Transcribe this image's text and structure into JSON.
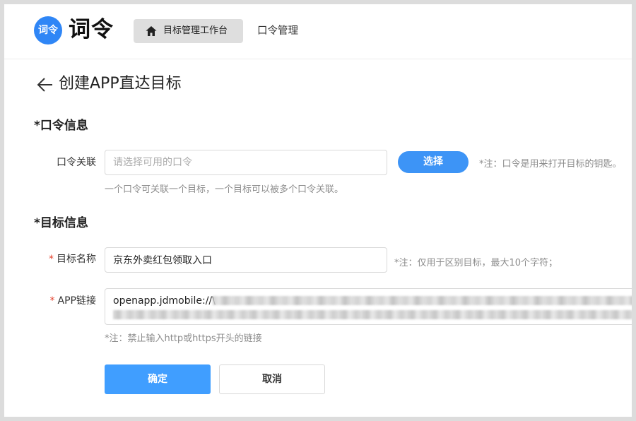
{
  "brand": {
    "badge_text": "词令",
    "name": "词令",
    "color": "#2f86f6"
  },
  "nav": {
    "active_label": "目标管理工作台",
    "active_icon": "home-icon",
    "items": [
      {
        "label": "口令管理"
      }
    ]
  },
  "page": {
    "title": "创建APP直达目标",
    "back_icon": "arrow-left-icon"
  },
  "sections": {
    "command_info": "*口令信息",
    "target_info": "*目标信息"
  },
  "command": {
    "label": "口令关联",
    "placeholder": "请选择可用的口令",
    "value": "",
    "select_button": "选择",
    "note": "*注：口令是用来打开目标的钥匙。",
    "help": "一个口令可关联一个目标，一个目标可以被多个口令关联。"
  },
  "target": {
    "name_label": "目标名称",
    "name_required_mark": "*",
    "name_value": "京东外卖红包领取入口",
    "name_note": "*注：仅用于区别目标，最大10个字符；",
    "link_label": "APP链接",
    "link_required_mark": "*",
    "link_value_visible": "openapp.jdmobile://\\",
    "link_note": "*注：禁止输入http或https开头的链接"
  },
  "actions": {
    "confirm": "确定",
    "cancel": "取消"
  },
  "colors": {
    "primary": "#409eff",
    "pill": "#3d94f6",
    "required": "#e4432f"
  }
}
